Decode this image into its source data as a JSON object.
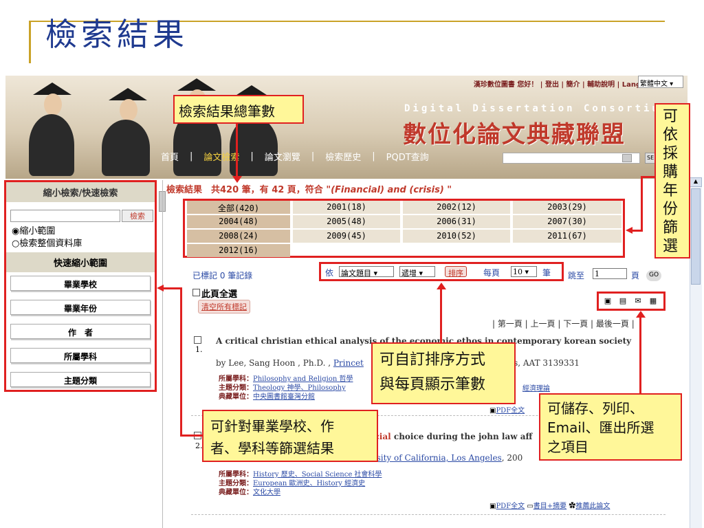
{
  "slide": {
    "title": "檢索結果"
  },
  "banner": {
    "top_links": "漢珍數位圖書 您好！ | 登出 | 簡介 | 輔助說明 | Language",
    "language": "繁體中文",
    "en_title": "Digital Dissertation Consortium",
    "zh_title": "數位化論文典藏聯盟",
    "nav": [
      "首頁",
      "論文檢索",
      "論文瀏覽",
      "檢索歷史",
      "PQDT查詢"
    ],
    "se_label": "SE"
  },
  "left_panel": {
    "header": "縮小檢索/快速檢索",
    "search_button": "檢索",
    "radio_narrow": "◉縮小範圍",
    "radio_all": "○檢索整個資料庫",
    "quick_header": "快速縮小範圍",
    "items": [
      "畢業學校",
      "畢業年份",
      "作　者",
      "所屬學科",
      "主題分類"
    ]
  },
  "results": {
    "header_prefix": "檢索結果　共420 筆，有 42 頁，符合 \"",
    "query": "(Financial) and (crisis)",
    "header_suffix": " \"",
    "years": [
      "全部(420)",
      "2001(18)",
      "2002(12)",
      "2003(29)",
      "2004(48)",
      "2005(48)",
      "2006(31)",
      "2007(30)",
      "2008(24)",
      "2009(45)",
      "2010(52)",
      "2011(67)",
      "2012(16)"
    ],
    "marked": "已標記 0 筆記錄",
    "sort_by_label": "依",
    "sort_field": "論文題目",
    "sort_order": "遞增",
    "sort_button": "排序",
    "per_page_label": "每頁",
    "per_page": "10",
    "per_page_unit": "筆",
    "jump_label": "跳至",
    "jump_value": "1",
    "page_unit": "頁",
    "go": "GO",
    "select_all": "此頁全選",
    "clear_marks": "清空所有標記",
    "pager": "| 第一頁 | 上一頁 | 下一頁 | 最後一頁 |"
  },
  "records": [
    {
      "num": "1.",
      "title": "A critical christian ethical analysis of the economic ethos in contemporary korean society",
      "author_line_a": "by Lee, Sang Hoon , Ph.D. , ",
      "author_link": "Princet",
      "author_line_b": "6Pages, AAT 3139331",
      "subject_label": "所屬學科：",
      "subject": "Philosophy and Religion 哲學",
      "topic_label": "主題分類：",
      "topic": "Theology 神學、Philosophy",
      "topic_extra": "經濟理論",
      "unit_label": "典藏單位：",
      "unit": "中央圖書館臺灣分館",
      "pdf": "PDF全文"
    },
    {
      "num": "2.",
      "title_highlight": "ancial",
      "title_rest": " choice during the john law aff",
      "author_link": "versity of California, Los Angeles",
      "author_line_b": ", 200",
      "subject_label": "所屬學科：",
      "subject": "History 歷史、Social Science 社會科學",
      "topic_label": "主題分類：",
      "topic": "European 歐洲史、History 經濟史",
      "unit_label": "典藏單位：",
      "unit": "文化大學",
      "pdf": "PDF全文",
      "toc": "書目+摘要",
      "recommend": "推薦此論文"
    }
  ],
  "callouts": {
    "total_count": "檢索結果總筆數",
    "year_filter": "可依採購年份篩選",
    "sort_custom_1": "可自訂排序方式",
    "sort_custom_2": "與每頁顯示筆數",
    "save_1": "可儲存、列印、",
    "save_2": "Email、匯出所選",
    "save_3": "之項目",
    "filter_1": "可針對畢業學校、作",
    "filter_2": "者、學科等篩選結果"
  },
  "colors": {
    "accent_red": "#e02020",
    "callout_bg": "#fff799",
    "title_blue": "#1f3a8f",
    "gold": "#c9a227"
  }
}
